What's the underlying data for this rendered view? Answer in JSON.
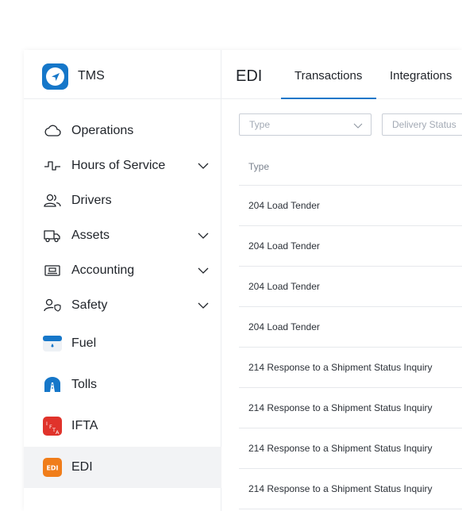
{
  "brand": {
    "title": "TMS"
  },
  "sidebar": {
    "items": [
      {
        "label": "Operations"
      },
      {
        "label": "Hours of Service"
      },
      {
        "label": "Drivers"
      },
      {
        "label": "Assets"
      },
      {
        "label": "Accounting"
      },
      {
        "label": "Safety"
      },
      {
        "label": "Fuel"
      },
      {
        "label": "Tolls"
      },
      {
        "label": "IFTA"
      },
      {
        "label": "EDI",
        "active": true
      }
    ],
    "ifta_badge_text": "IFTA",
    "edi_badge_text": "EDI"
  },
  "header": {
    "title": "EDI",
    "tabs": [
      {
        "label": "Transactions",
        "active": true
      },
      {
        "label": "Integrations"
      }
    ]
  },
  "filters": {
    "type_placeholder": "Type",
    "delivery_status_placeholder": "Delivery Status"
  },
  "table": {
    "columns": [
      "Type"
    ],
    "rows": [
      "204 Load Tender",
      "204 Load Tender",
      "204 Load Tender",
      "204 Load Tender",
      "214 Response to a Shipment Status Inquiry",
      "214 Response to a Shipment Status Inquiry",
      "214 Response to a Shipment Status Inquiry",
      "214 Response to a Shipment Status Inquiry"
    ]
  },
  "colors": {
    "accent": "#1677c9",
    "fuel": "#1677c9",
    "tolls": "#1677c9",
    "ifta": "#e0332b",
    "edi": "#f07d1a",
    "active_bg": "#f2f3f5"
  },
  "icons": {
    "brand": "navigation-arrow-icon",
    "operations": "cloud-icon",
    "hours_of_service": "signal-pulse-icon",
    "drivers": "users-icon",
    "assets": "truck-icon",
    "accounting": "card-icon",
    "safety": "user-shield-icon",
    "fuel": "fuel-icon",
    "tolls": "toll-road-icon",
    "ifta": "ifta-icon",
    "edi": "edi-icon"
  }
}
